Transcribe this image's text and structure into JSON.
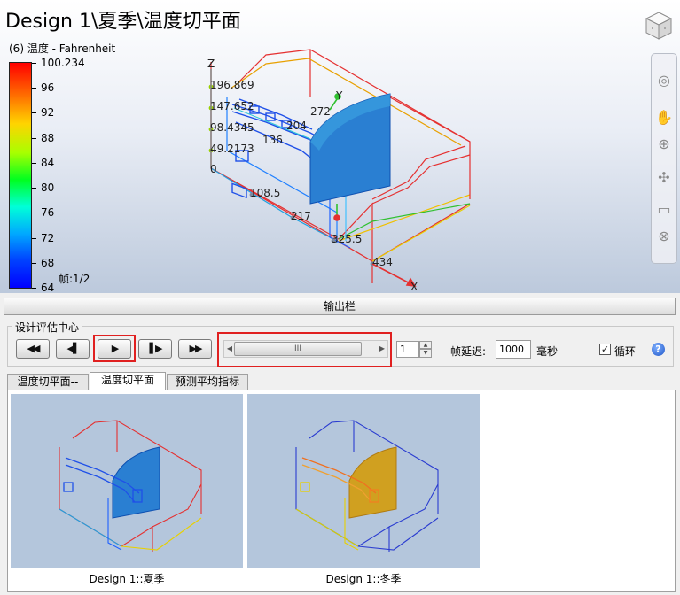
{
  "viewport": {
    "title": "Design 1\\夏季\\温度切平面",
    "legend": {
      "title": "(6) 温度 - Fahrenheit",
      "ticks": [
        "100.234",
        "96",
        "92",
        "88",
        "84",
        "80",
        "76",
        "72",
        "68",
        "64"
      ],
      "frame": "帧:1/2"
    },
    "axes": {
      "z_label": "Z",
      "y_label": "Y",
      "x_label": "X",
      "z_ticks": [
        "196.869",
        "147.652",
        "98.4345",
        "49.2173",
        "0"
      ],
      "x_ticks": [
        "108.5",
        "217",
        "325.5",
        "434"
      ],
      "y_ticks": [
        "136",
        "204",
        "272"
      ]
    }
  },
  "output_bar": {
    "label": "输出栏"
  },
  "eval_center": {
    "title": "设计评估中心",
    "controls": {
      "rewind": "◀◀",
      "step_back": "◀▌",
      "play": "▶",
      "step_forward": "▌▶",
      "fast_forward": "▶▶",
      "slider_grip": "III",
      "frame_value": "1",
      "delay_label": "帧延迟:",
      "delay_value": "1000",
      "delay_unit": "毫秒",
      "loop_label": "循环",
      "loop_checked": true
    }
  },
  "tabs": [
    {
      "label": "温度切平面--"
    },
    {
      "label": "温度切平面",
      "active": true
    },
    {
      "label": "预测平均指标"
    }
  ],
  "thumbnails": [
    {
      "caption": "Design 1::夏季"
    },
    {
      "caption": "Design 1::冬季"
    }
  ],
  "icons": {
    "viewcube": "view-cube-icon",
    "nav": [
      "orbit-icon",
      "pan-hand-icon",
      "zoom-icon",
      "walk-icon",
      "camera-icon",
      "close-icon"
    ]
  }
}
